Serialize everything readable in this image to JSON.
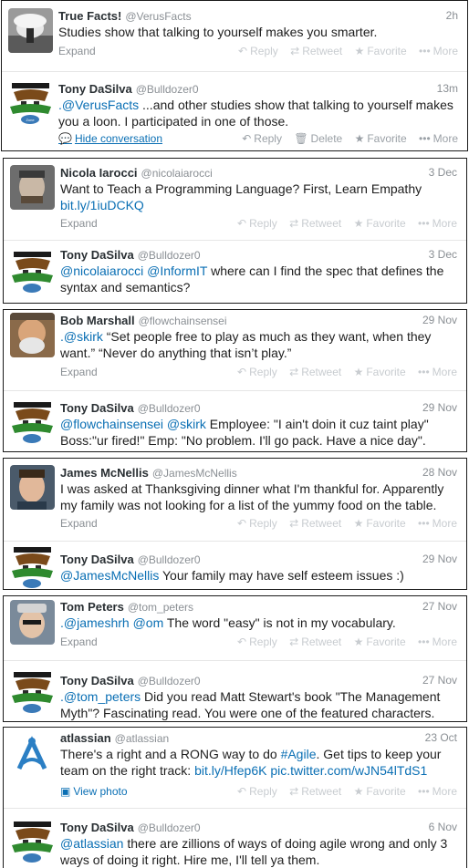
{
  "actions": {
    "expand": "Expand",
    "reply": "Reply",
    "retweet": "Retweet",
    "favorite": "Favorite",
    "more": "More",
    "delete": "Delete",
    "hide_conversation": "Hide conversation",
    "view_photo": "View photo"
  },
  "icons": {
    "reply": "reply-arrow-icon",
    "retweet": "retweet-icon",
    "favorite": "star-icon",
    "more": "ellipsis-icon",
    "delete": "trash-icon",
    "hide_conversation": "speech-bubble-icon",
    "view_photo": "photo-icon"
  },
  "conversations": [
    {
      "tweets": [
        {
          "name": "True Facts!",
          "handle": "@VerusFacts",
          "time": "2h",
          "text": "Studies show that talking to yourself makes you smarter."
        },
        {
          "name": "Tony DaSilva",
          "handle": "@Bulldozer0",
          "time": "13m",
          "mention": ".@VerusFacts",
          "text": " ...and other studies show that talking to yourself makes you a loon. I participated in one of those."
        }
      ]
    },
    {
      "tweets": [
        {
          "name": "Nicola Iarocci",
          "handle": "@nicolaiarocci",
          "time": "3 Dec",
          "text": "Want to Teach a Programming Language? First, Learn Empathy ",
          "link": "bit.ly/1iuDCKQ"
        },
        {
          "name": "Tony DaSilva",
          "handle": "@Bulldozer0",
          "time": "3 Dec",
          "mention": "@nicolaiarocci @InformIT",
          "text": " where can I find the spec that defines the syntax and semantics?"
        }
      ]
    },
    {
      "tweets": [
        {
          "name": "Bob Marshall",
          "handle": "@flowchainsensei",
          "time": "29 Nov",
          "mention": ".@skirk",
          "text": " “Set people free to play as much as they want, when they want.” “Never do anything that isn’t play.”"
        },
        {
          "name": "Tony DaSilva",
          "handle": "@Bulldozer0",
          "time": "29 Nov",
          "mention": "@flowchainsensei @skirk",
          "text": " Employee: \"I ain't doin it cuz taint play\" Boss:\"ur fired!\"  Emp: \"No problem. I'll go pack. Have a nice day\"."
        }
      ]
    },
    {
      "tweets": [
        {
          "name": "James McNellis",
          "handle": "@JamesMcNellis",
          "time": "28 Nov",
          "text": "I was asked at Thanksgiving dinner what I'm thankful for. Apparently my family was not looking for a list of the yummy food on the table."
        },
        {
          "name": "Tony DaSilva",
          "handle": "@Bulldozer0",
          "time": "29 Nov",
          "mention": "@JamesMcNellis",
          "text": " Your family may have self esteem issues :)"
        }
      ]
    },
    {
      "tweets": [
        {
          "name": "Tom Peters",
          "handle": "@tom_peters",
          "time": "27 Nov",
          "mention": ".@jameshrh @om",
          "text": " The word \"easy\" is not in my vocabulary."
        },
        {
          "name": "Tony DaSilva",
          "handle": "@Bulldozer0",
          "time": "27 Nov",
          "mention": ".@tom_peters",
          "text": " Did you read Matt Stewart's book \"The Management Myth\"? Fascinating read. You were one of the featured characters."
        }
      ]
    },
    {
      "tweets": [
        {
          "name": "atlassian",
          "handle": "@atlassian",
          "time": "23 Oct",
          "text_a": "There's a right and a RONG way to do ",
          "hashtag": "#Agile",
          "text_b": ". Get tips to keep your team on the right track: ",
          "link": "bit.ly/Hfep6K pic.twitter.com/wJN54lTdS1"
        },
        {
          "name": "Tony DaSilva",
          "handle": "@Bulldozer0",
          "time": "6 Nov",
          "mention": "@atlassian",
          "text": " there are zillions of ways of doing agile wrong and only 3 ways of doing it right. Hire me, I'll tell ya them."
        }
      ]
    }
  ]
}
